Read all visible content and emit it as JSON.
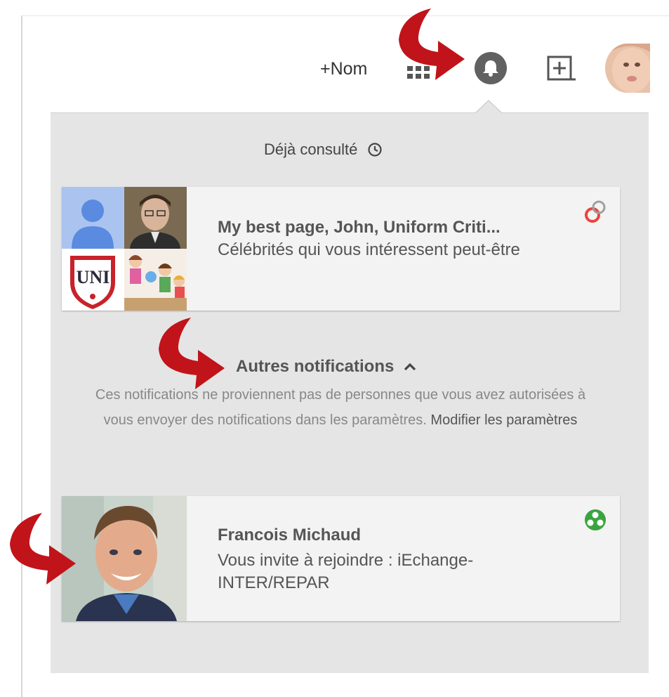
{
  "topbar": {
    "name_label": "+Nom",
    "icons": {
      "apps": "apps-grid-icon",
      "notifications": "bell-icon",
      "share": "add-box-icon",
      "avatar": "profile-avatar"
    }
  },
  "panel": {
    "seen_section": {
      "label": "Déjà consulté",
      "icon": "clock-icon"
    },
    "seen_card": {
      "title": "My best page, John, Uniform Criti...",
      "subtitle": "Célébrités qui vous intéressent peut-être",
      "badge_text": "UNI",
      "icon": "google-plus-icon"
    },
    "other_section": {
      "title": "Autres notifications",
      "icon": "chevron-up-icon",
      "description": "Ces notifications ne proviennent pas de personnes que vous avez autorisées à vous envoyer des notifications dans les paramètres.",
      "link": "Modifier les paramètres"
    },
    "invite_card": {
      "name": "Francois Michaud",
      "message": "Vous invite à rejoindre : iEchange-INTER/REPAR",
      "icon": "community-icon"
    }
  },
  "colors": {
    "panel_bg": "#e5e5e5",
    "card_bg": "#f3f3f3",
    "arrow": "#c0141a",
    "community_green": "#3aa540",
    "google_red": "#e8453c"
  }
}
